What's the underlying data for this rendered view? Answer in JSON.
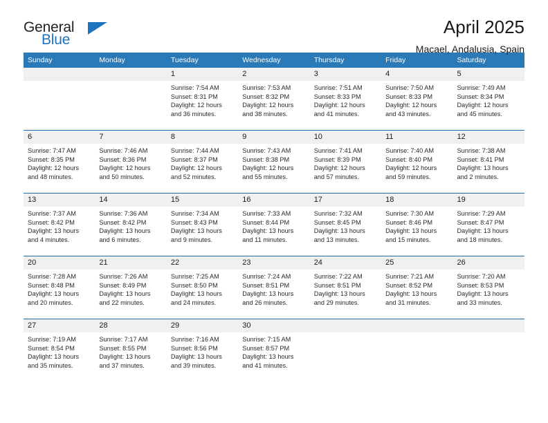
{
  "brand": {
    "name_part1": "General",
    "name_part2": "Blue",
    "accent_color": "#1e73be"
  },
  "header": {
    "title": "April 2025",
    "subtitle": "Macael, Andalusia, Spain"
  },
  "calendar": {
    "header_background": "#2b7ab8",
    "row_divider_color": "#1e6bb0",
    "daynum_background": "#f0f0f0",
    "weekday_headers": [
      "Sunday",
      "Monday",
      "Tuesday",
      "Wednesday",
      "Thursday",
      "Friday",
      "Saturday"
    ],
    "weeks": [
      [
        {
          "day": "",
          "lines": []
        },
        {
          "day": "",
          "lines": []
        },
        {
          "day": "1",
          "lines": [
            "Sunrise: 7:54 AM",
            "Sunset: 8:31 PM",
            "Daylight: 12 hours",
            "and 36 minutes."
          ]
        },
        {
          "day": "2",
          "lines": [
            "Sunrise: 7:53 AM",
            "Sunset: 8:32 PM",
            "Daylight: 12 hours",
            "and 38 minutes."
          ]
        },
        {
          "day": "3",
          "lines": [
            "Sunrise: 7:51 AM",
            "Sunset: 8:33 PM",
            "Daylight: 12 hours",
            "and 41 minutes."
          ]
        },
        {
          "day": "4",
          "lines": [
            "Sunrise: 7:50 AM",
            "Sunset: 8:33 PM",
            "Daylight: 12 hours",
            "and 43 minutes."
          ]
        },
        {
          "day": "5",
          "lines": [
            "Sunrise: 7:49 AM",
            "Sunset: 8:34 PM",
            "Daylight: 12 hours",
            "and 45 minutes."
          ]
        }
      ],
      [
        {
          "day": "6",
          "lines": [
            "Sunrise: 7:47 AM",
            "Sunset: 8:35 PM",
            "Daylight: 12 hours",
            "and 48 minutes."
          ]
        },
        {
          "day": "7",
          "lines": [
            "Sunrise: 7:46 AM",
            "Sunset: 8:36 PM",
            "Daylight: 12 hours",
            "and 50 minutes."
          ]
        },
        {
          "day": "8",
          "lines": [
            "Sunrise: 7:44 AM",
            "Sunset: 8:37 PM",
            "Daylight: 12 hours",
            "and 52 minutes."
          ]
        },
        {
          "day": "9",
          "lines": [
            "Sunrise: 7:43 AM",
            "Sunset: 8:38 PM",
            "Daylight: 12 hours",
            "and 55 minutes."
          ]
        },
        {
          "day": "10",
          "lines": [
            "Sunrise: 7:41 AM",
            "Sunset: 8:39 PM",
            "Daylight: 12 hours",
            "and 57 minutes."
          ]
        },
        {
          "day": "11",
          "lines": [
            "Sunrise: 7:40 AM",
            "Sunset: 8:40 PM",
            "Daylight: 12 hours",
            "and 59 minutes."
          ]
        },
        {
          "day": "12",
          "lines": [
            "Sunrise: 7:38 AM",
            "Sunset: 8:41 PM",
            "Daylight: 13 hours",
            "and 2 minutes."
          ]
        }
      ],
      [
        {
          "day": "13",
          "lines": [
            "Sunrise: 7:37 AM",
            "Sunset: 8:42 PM",
            "Daylight: 13 hours",
            "and 4 minutes."
          ]
        },
        {
          "day": "14",
          "lines": [
            "Sunrise: 7:36 AM",
            "Sunset: 8:42 PM",
            "Daylight: 13 hours",
            "and 6 minutes."
          ]
        },
        {
          "day": "15",
          "lines": [
            "Sunrise: 7:34 AM",
            "Sunset: 8:43 PM",
            "Daylight: 13 hours",
            "and 9 minutes."
          ]
        },
        {
          "day": "16",
          "lines": [
            "Sunrise: 7:33 AM",
            "Sunset: 8:44 PM",
            "Daylight: 13 hours",
            "and 11 minutes."
          ]
        },
        {
          "day": "17",
          "lines": [
            "Sunrise: 7:32 AM",
            "Sunset: 8:45 PM",
            "Daylight: 13 hours",
            "and 13 minutes."
          ]
        },
        {
          "day": "18",
          "lines": [
            "Sunrise: 7:30 AM",
            "Sunset: 8:46 PM",
            "Daylight: 13 hours",
            "and 15 minutes."
          ]
        },
        {
          "day": "19",
          "lines": [
            "Sunrise: 7:29 AM",
            "Sunset: 8:47 PM",
            "Daylight: 13 hours",
            "and 18 minutes."
          ]
        }
      ],
      [
        {
          "day": "20",
          "lines": [
            "Sunrise: 7:28 AM",
            "Sunset: 8:48 PM",
            "Daylight: 13 hours",
            "and 20 minutes."
          ]
        },
        {
          "day": "21",
          "lines": [
            "Sunrise: 7:26 AM",
            "Sunset: 8:49 PM",
            "Daylight: 13 hours",
            "and 22 minutes."
          ]
        },
        {
          "day": "22",
          "lines": [
            "Sunrise: 7:25 AM",
            "Sunset: 8:50 PM",
            "Daylight: 13 hours",
            "and 24 minutes."
          ]
        },
        {
          "day": "23",
          "lines": [
            "Sunrise: 7:24 AM",
            "Sunset: 8:51 PM",
            "Daylight: 13 hours",
            "and 26 minutes."
          ]
        },
        {
          "day": "24",
          "lines": [
            "Sunrise: 7:22 AM",
            "Sunset: 8:51 PM",
            "Daylight: 13 hours",
            "and 29 minutes."
          ]
        },
        {
          "day": "25",
          "lines": [
            "Sunrise: 7:21 AM",
            "Sunset: 8:52 PM",
            "Daylight: 13 hours",
            "and 31 minutes."
          ]
        },
        {
          "day": "26",
          "lines": [
            "Sunrise: 7:20 AM",
            "Sunset: 8:53 PM",
            "Daylight: 13 hours",
            "and 33 minutes."
          ]
        }
      ],
      [
        {
          "day": "27",
          "lines": [
            "Sunrise: 7:19 AM",
            "Sunset: 8:54 PM",
            "Daylight: 13 hours",
            "and 35 minutes."
          ]
        },
        {
          "day": "28",
          "lines": [
            "Sunrise: 7:17 AM",
            "Sunset: 8:55 PM",
            "Daylight: 13 hours",
            "and 37 minutes."
          ]
        },
        {
          "day": "29",
          "lines": [
            "Sunrise: 7:16 AM",
            "Sunset: 8:56 PM",
            "Daylight: 13 hours",
            "and 39 minutes."
          ]
        },
        {
          "day": "30",
          "lines": [
            "Sunrise: 7:15 AM",
            "Sunset: 8:57 PM",
            "Daylight: 13 hours",
            "and 41 minutes."
          ]
        },
        {
          "day": "",
          "lines": []
        },
        {
          "day": "",
          "lines": []
        },
        {
          "day": "",
          "lines": []
        }
      ]
    ]
  }
}
